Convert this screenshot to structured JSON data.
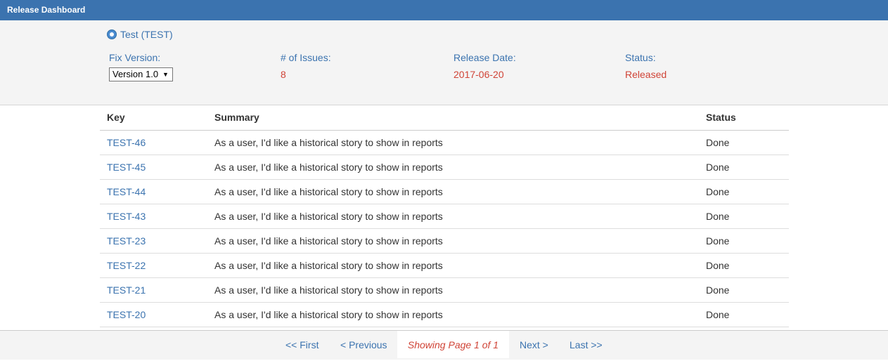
{
  "window": {
    "title": "Release Dashboard"
  },
  "project": {
    "name": "Test (TEST)",
    "icon": "project-avatar-icon"
  },
  "fields": {
    "fix_version_label": "Fix Version:",
    "fix_version_value": "Version 1.0",
    "issues_label": "# of Issues:",
    "issues_value": "8",
    "release_date_label": "Release Date:",
    "release_date_value": "2017-06-20",
    "status_label": "Status:",
    "status_value": "Released"
  },
  "table": {
    "headers": {
      "key": "Key",
      "summary": "Summary",
      "status": "Status"
    },
    "rows": [
      {
        "key": "TEST-46",
        "summary": "As a user, I'd like a historical story to show in reports",
        "status": "Done"
      },
      {
        "key": "TEST-45",
        "summary": "As a user, I'd like a historical story to show in reports",
        "status": "Done"
      },
      {
        "key": "TEST-44",
        "summary": "As a user, I'd like a historical story to show in reports",
        "status": "Done"
      },
      {
        "key": "TEST-43",
        "summary": "As a user, I'd like a historical story to show in reports",
        "status": "Done"
      },
      {
        "key": "TEST-23",
        "summary": "As a user, I'd like a historical story to show in reports",
        "status": "Done"
      },
      {
        "key": "TEST-22",
        "summary": "As a user, I'd like a historical story to show in reports",
        "status": "Done"
      },
      {
        "key": "TEST-21",
        "summary": "As a user, I'd like a historical story to show in reports",
        "status": "Done"
      },
      {
        "key": "TEST-20",
        "summary": "As a user, I'd like a historical story to show in reports",
        "status": "Done"
      }
    ]
  },
  "pager": {
    "first": "<< First",
    "previous": "< Previous",
    "current": "Showing Page 1 of 1",
    "next": "Next >",
    "last": "Last >>"
  },
  "colors": {
    "accent": "#3b73af",
    "highlight": "#d04437",
    "panel": "#f4f4f4"
  }
}
